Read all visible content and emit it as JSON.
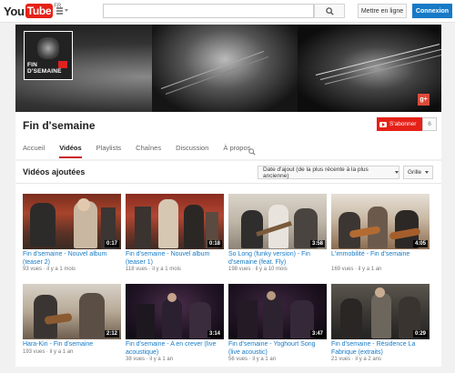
{
  "masthead": {
    "logo_you": "You",
    "logo_tube": "Tube",
    "logo_region": "FR",
    "search_placeholder": "",
    "upload_label": "Mettre en ligne",
    "signin_label": "Connexion"
  },
  "channel": {
    "avatar_text": "FIN D'SEMAINE",
    "title": "Fin d'semaine",
    "subscribe_label": "S'abonner",
    "subscriber_count": "6",
    "gplus_label": "g+",
    "tabs": [
      {
        "label": "Accueil"
      },
      {
        "label": "Vidéos"
      },
      {
        "label": "Playlists"
      },
      {
        "label": "Chaînes"
      },
      {
        "label": "Discussion"
      },
      {
        "label": "À propos"
      }
    ]
  },
  "uploads": {
    "section_title": "Vidéos ajoutées",
    "sort_label": "Date d'ajout (de la plus récente à la plus ancienne)",
    "view_label": "Grille",
    "videos": [
      {
        "title": "Fin d'semaine - Nouvel album (teaser 2)",
        "views": "93 vues",
        "age": "il y a 1 mois",
        "duration": "0:17"
      },
      {
        "title": "Fin d'semaine - Nouvel album (teaser 1)",
        "views": "118 vues",
        "age": "il y a 1 mois",
        "duration": "0:18"
      },
      {
        "title": "So Long (funky version) - Fin d'semaine (feat. Fly)",
        "views": "198 vues",
        "age": "il y a 10 mois",
        "duration": "3:58"
      },
      {
        "title": "L'immobilité - Fin d'semaine",
        "views": "169 vues",
        "age": "il y a 1 an",
        "duration": "4:05"
      },
      {
        "title": "Hara-Kiri - Fin d'semaine",
        "views": "193 vues",
        "age": "il y a 1 an",
        "duration": "2:12"
      },
      {
        "title": "Fin d'semaine - A en crever (live acoustique)",
        "views": "38 vues",
        "age": "il y a 1 an",
        "duration": "3:14"
      },
      {
        "title": "Fin d'semaine - Yoghourt Song (live acoustic)",
        "views": "56 vues",
        "age": "il y a 1 an",
        "duration": "3:47"
      },
      {
        "title": "Fin d'semaine - Résidence La Fabrique (extraits)",
        "views": "21 vues",
        "age": "il y a 2 ans",
        "duration": "0:29"
      }
    ]
  }
}
